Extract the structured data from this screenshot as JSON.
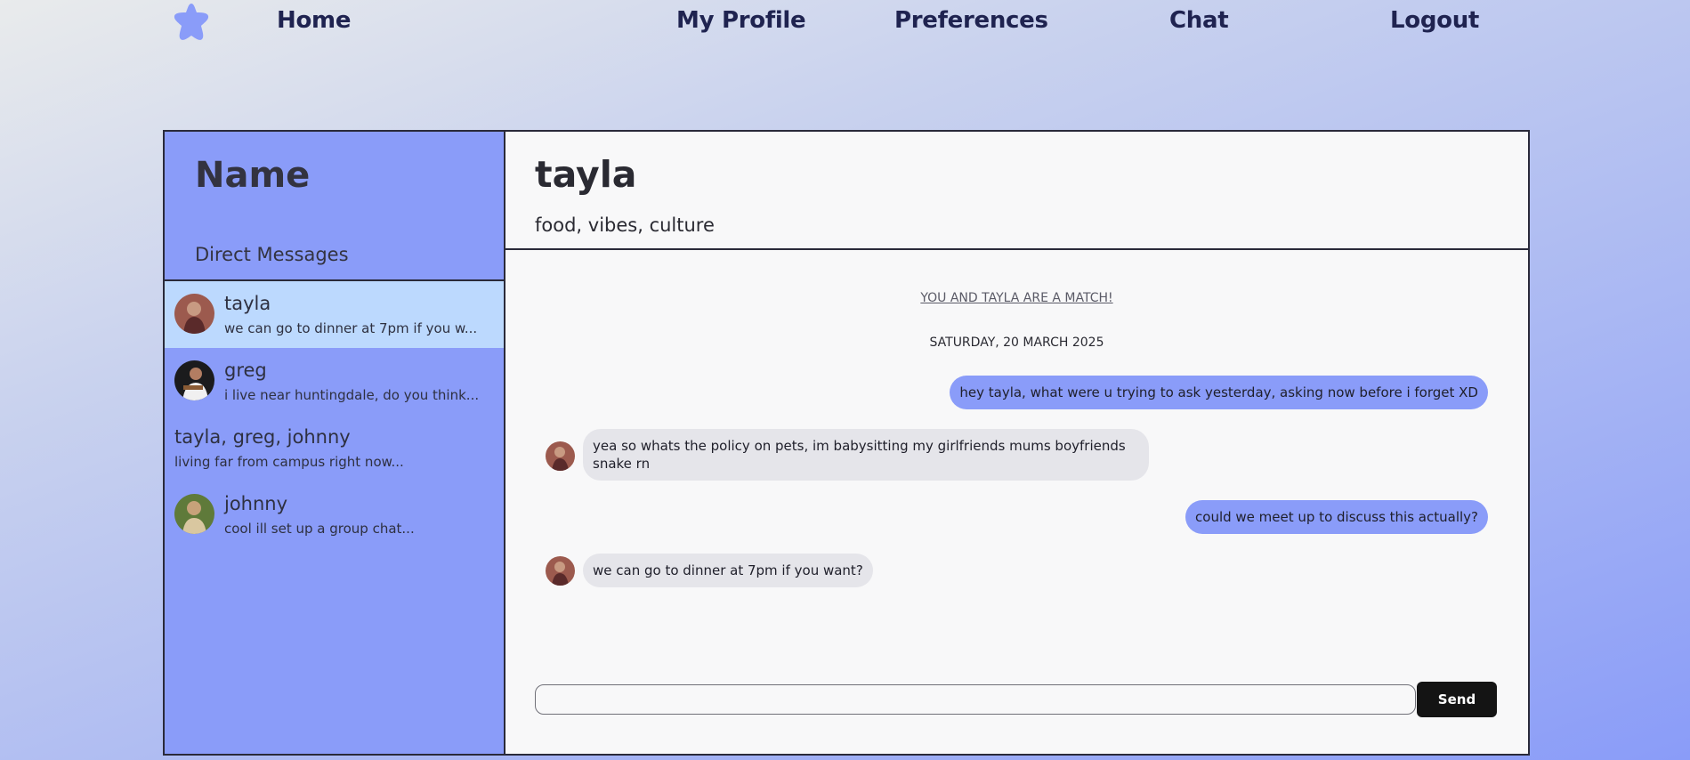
{
  "nav": {
    "logo_icon": "star-icon",
    "links": [
      "Home",
      "My Profile",
      "Preferences",
      "Chat",
      "Logout"
    ]
  },
  "colors": {
    "accent": "#8a9cf9",
    "active_conversation": "#bcd9fe",
    "send_button": "#141414"
  },
  "sidebar": {
    "title": "Name",
    "section_label": "Direct Messages",
    "conversations": [
      {
        "name": "tayla",
        "preview": "we can go to dinner at 7pm if you w...",
        "active": true
      },
      {
        "name": "greg",
        "preview": "i live near huntingdale, do you think..."
      },
      {
        "name": "tayla, greg, johnny",
        "preview": "living far from campus right now..."
      },
      {
        "name": "johnny",
        "preview": "cool ill set up a group chat..."
      }
    ]
  },
  "chat": {
    "name": "tayla",
    "interests": "food, vibes, culture",
    "match_note": "YOU AND TAYLA ARE A MATCH!",
    "date": "SATURDAY, 20 MARCH 2025",
    "messages": [
      {
        "from": "me",
        "text": "hey tayla, what were u trying to ask yesterday, asking now before i forget XD"
      },
      {
        "from": "tayla",
        "text": "yea so whats the policy on pets, im babysitting my girlfriends mums boyfriends snake rn"
      },
      {
        "from": "me",
        "text": "could we meet up to discuss this actually?"
      },
      {
        "from": "tayla",
        "text": "we can go to dinner at 7pm if you want?"
      }
    ],
    "input_value": "",
    "send_label": "Send"
  }
}
